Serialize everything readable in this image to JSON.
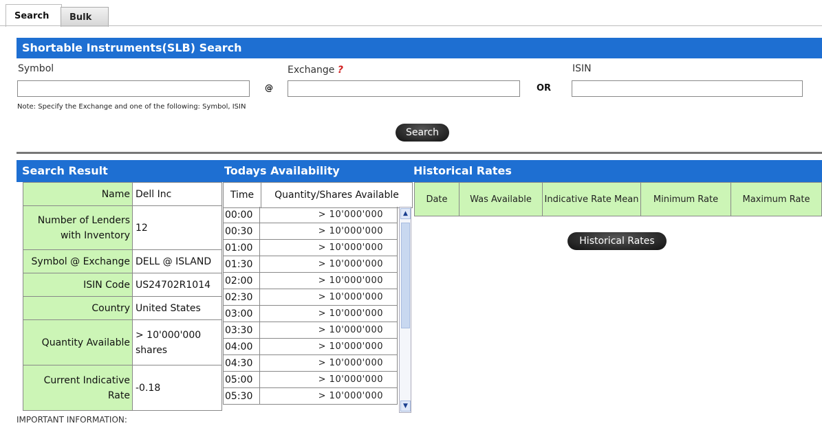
{
  "tabs": [
    {
      "label": "Search"
    },
    {
      "label": "Bulk"
    }
  ],
  "search_panel": {
    "title": "Shortable Instruments(SLB) Search",
    "symbol_label": "Symbol",
    "exchange_label": "Exchange",
    "exchange_help": "?",
    "isin_label": "ISIN",
    "at_symbol": "@",
    "or_label": "OR",
    "symbol_value": "",
    "exchange_value": "",
    "isin_value": "",
    "note": "Note: Specify the Exchange and one of the following: Symbol, ISIN",
    "search_button": "Search"
  },
  "results": {
    "search_result_title": "Search Result",
    "availability_title": "Todays Availability",
    "historical_title": "Historical Rates",
    "fields": [
      {
        "key": "Name",
        "value": "Dell Inc"
      },
      {
        "key": "Number of Lenders with Inventory",
        "value": "12"
      },
      {
        "key": "Symbol @ Exchange",
        "value": "DELL @ ISLAND"
      },
      {
        "key": "ISIN Code",
        "value": "US24702R1014"
      },
      {
        "key": "Country",
        "value": "United States"
      },
      {
        "key": "Quantity Available",
        "value": "> 10'000'000 shares"
      },
      {
        "key": "Current Indicative Rate",
        "value": "-0.18"
      }
    ],
    "availability_headers": {
      "time": "Time",
      "quantity": "Quantity/Shares Available"
    },
    "availability_rows": [
      {
        "time": "00:00",
        "quantity": "> 10'000'000"
      },
      {
        "time": "00:30",
        "quantity": "> 10'000'000"
      },
      {
        "time": "01:00",
        "quantity": "> 10'000'000"
      },
      {
        "time": "01:30",
        "quantity": "> 10'000'000"
      },
      {
        "time": "02:00",
        "quantity": "> 10'000'000"
      },
      {
        "time": "02:30",
        "quantity": "> 10'000'000"
      },
      {
        "time": "03:00",
        "quantity": "> 10'000'000"
      },
      {
        "time": "03:30",
        "quantity": "> 10'000'000"
      },
      {
        "time": "04:00",
        "quantity": "> 10'000'000"
      },
      {
        "time": "04:30",
        "quantity": "> 10'000'000"
      },
      {
        "time": "05:00",
        "quantity": "> 10'000'000"
      },
      {
        "time": "05:30",
        "quantity": "> 10'000'000"
      }
    ],
    "historical_headers": [
      "Date",
      "Was Available",
      "Indicative Rate Mean",
      "Minimum Rate",
      "Maximum Rate"
    ],
    "historical_button": "Historical Rates"
  },
  "footer": {
    "important": "IMPORTANT INFORMATION:"
  },
  "colors": {
    "accent": "#1e6fd2",
    "key_bg": "#ccf5b6",
    "required": "#d02020"
  }
}
